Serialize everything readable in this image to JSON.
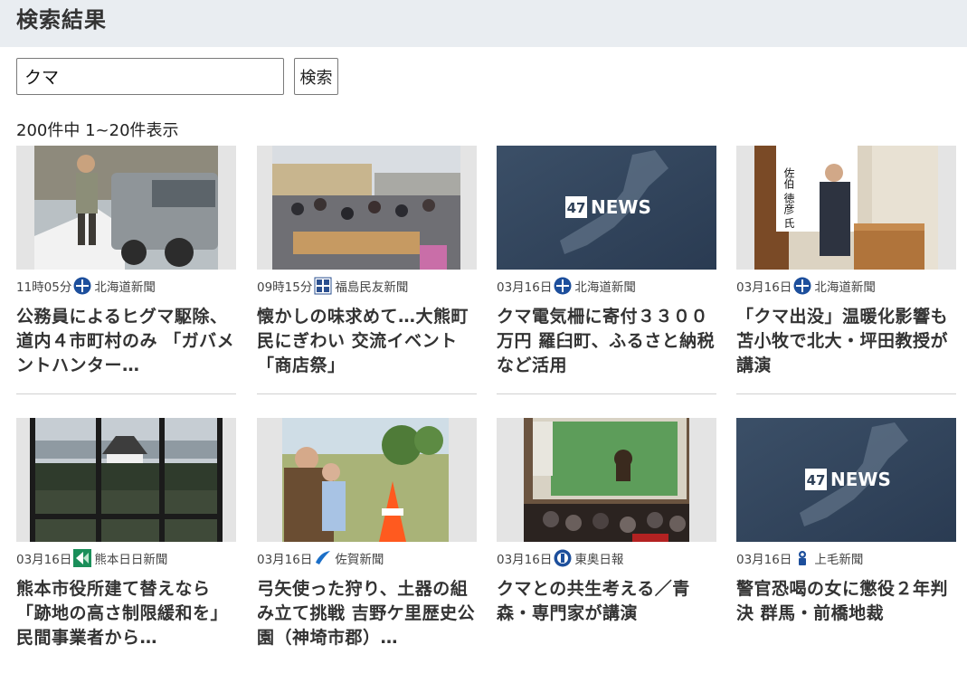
{
  "page": {
    "title": "検索結果"
  },
  "search": {
    "value": "クマ",
    "button_label": "検索"
  },
  "results": {
    "count_text": "200件中 1~20件表示",
    "items": [
      {
        "time": "11時05分",
        "source": "北海道新聞",
        "source_logo": "hokkaido-shimbun-logo",
        "headline": "公務員によるヒグマ駆除、道内４市町村のみ 「ガバメントハンター…"
      },
      {
        "time": "09時15分",
        "source": "福島民友新聞",
        "source_logo": "fukushima-minyu-logo",
        "headline": "懐かしの味求めて…大熊町民にぎわい 交流イベント「商店祭」"
      },
      {
        "time": "03月16日",
        "source": "北海道新聞",
        "source_logo": "hokkaido-shimbun-logo",
        "headline": "クマ電気柵に寄付３３００万円 羅臼町、ふるさと納税など活用",
        "thumb_text": "47NEWS"
      },
      {
        "time": "03月16日",
        "source": "北海道新聞",
        "source_logo": "hokkaido-shimbun-logo",
        "headline": "「クマ出没」温暖化影響も 苫小牧で北大・坪田教授が講演",
        "sign_text": "佐伯 徳彦 氏"
      },
      {
        "time": "03月16日",
        "source": "熊本日日新聞",
        "source_logo": "kumamoto-nichinichi-logo",
        "headline": "熊本市役所建て替えなら「跡地の高さ制限緩和を」 民間事業者から…"
      },
      {
        "time": "03月16日",
        "source": "佐賀新聞",
        "source_logo": "saga-shimbun-logo",
        "headline": "弓矢使った狩り、土器の組み立て挑戦 吉野ケ里歴史公園（神埼市郡）…"
      },
      {
        "time": "03月16日",
        "source": "東奥日報",
        "source_logo": "too-nippo-logo",
        "headline": "クマとの共生考える／青森・専門家が講演"
      },
      {
        "time": "03月16日",
        "source": "上毛新聞",
        "source_logo": "jomo-shimbun-logo",
        "headline": "警官恐喝の女に懲役２年判決 群馬・前橋地裁",
        "thumb_text": "47NEWS"
      }
    ]
  }
}
